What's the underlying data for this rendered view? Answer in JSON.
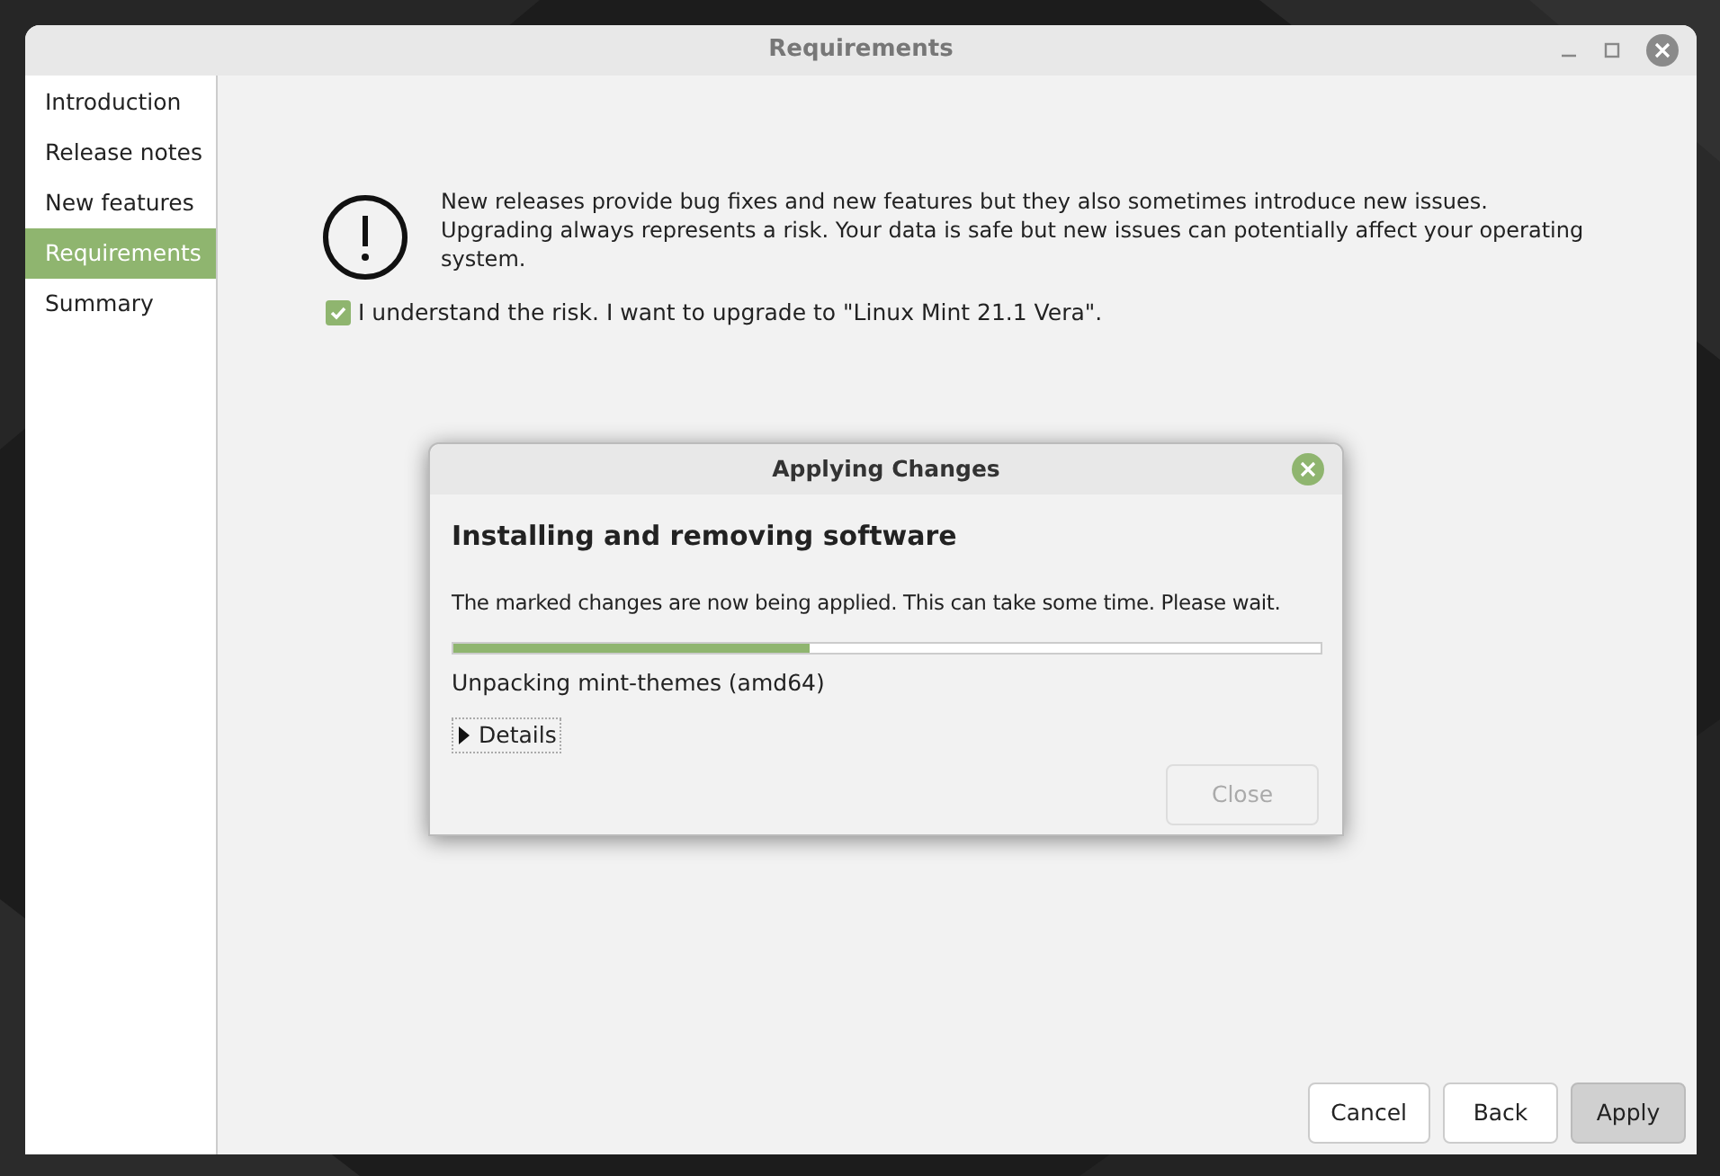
{
  "window": {
    "title": "Requirements"
  },
  "sidebar": {
    "items": [
      {
        "label": "Introduction",
        "selected": false
      },
      {
        "label": "Release notes",
        "selected": false
      },
      {
        "label": "New features",
        "selected": false
      },
      {
        "label": "Requirements",
        "selected": true
      },
      {
        "label": "Summary",
        "selected": false
      }
    ]
  },
  "warning": {
    "text": "New releases provide bug fixes and new features but they also sometimes introduce new issues. Upgrading always represents a risk. Your data is safe but new issues can potentially affect your operating system."
  },
  "agree_checkbox": {
    "label": "I understand the risk. I want to upgrade to \"Linux Mint 21.1 Vera\".",
    "checked": true
  },
  "dialog": {
    "title": "Applying Changes",
    "heading": "Installing and removing software",
    "message": "The marked changes are now being applied. This can take some time. Please wait.",
    "progress": {
      "level": 0.41
    },
    "status": "Unpacking mint-themes (amd64)",
    "details": {
      "label": "Details",
      "expanded": false
    },
    "close_button": {
      "label": "Close",
      "disabled": true
    }
  },
  "buttons": [
    {
      "label": "Cancel",
      "default": false
    },
    {
      "label": "Back",
      "default": false
    },
    {
      "label": "Apply",
      "default": true
    }
  ]
}
